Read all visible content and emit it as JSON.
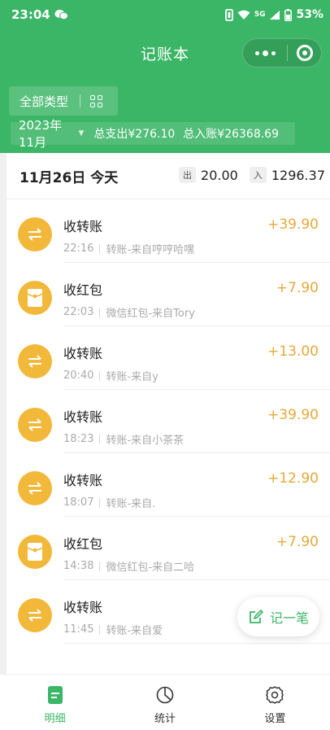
{
  "status_bar": {
    "time": "23:04",
    "network": "5G",
    "battery": "53%"
  },
  "title_bar": {
    "title": "记账本"
  },
  "filter": {
    "type_label": "全部类型"
  },
  "summary": {
    "month": "2023年11月",
    "expense": "总支出¥276.10",
    "income": "总入账¥26368.69"
  },
  "day": {
    "title": "11月26日 今天",
    "out_tag": "出",
    "out_value": "20.00",
    "in_tag": "入",
    "in_value": "1296.37"
  },
  "transactions": [
    {
      "icon": "transfer-icon",
      "name": "收转账",
      "time": "22:16",
      "desc": "转账-来自哼哼哈嘿",
      "amount": "+39.90"
    },
    {
      "icon": "red-packet-icon",
      "name": "收红包",
      "time": "22:03",
      "desc": "微信红包-来自Tory",
      "amount": "+7.90"
    },
    {
      "icon": "transfer-icon",
      "name": "收转账",
      "time": "20:40",
      "desc": "转账-来自y",
      "amount": "+13.00"
    },
    {
      "icon": "transfer-icon",
      "name": "收转账",
      "time": "18:23",
      "desc": "转账-来自小茶茶",
      "amount": "+39.90"
    },
    {
      "icon": "transfer-icon",
      "name": "收转账",
      "time": "18:07",
      "desc": "转账-来自.",
      "amount": "+12.90"
    },
    {
      "icon": "red-packet-icon",
      "name": "收红包",
      "time": "14:38",
      "desc": "微信红包-来自二哈",
      "amount": "+7.90"
    },
    {
      "icon": "transfer-icon",
      "name": "收转账",
      "time": "11:45",
      "desc": "转账-来自爱",
      "amount": ""
    }
  ],
  "fab": {
    "label": "记一笔"
  },
  "tabbar": [
    {
      "label": "明细",
      "icon": "document-icon",
      "active": true
    },
    {
      "label": "统计",
      "icon": "pie-chart-icon",
      "active": false
    },
    {
      "label": "设置",
      "icon": "gear-icon",
      "active": false
    }
  ],
  "colors": {
    "primary": "#3bb566",
    "income": "#e6a93a",
    "icon_bg": "#f2b83a"
  }
}
